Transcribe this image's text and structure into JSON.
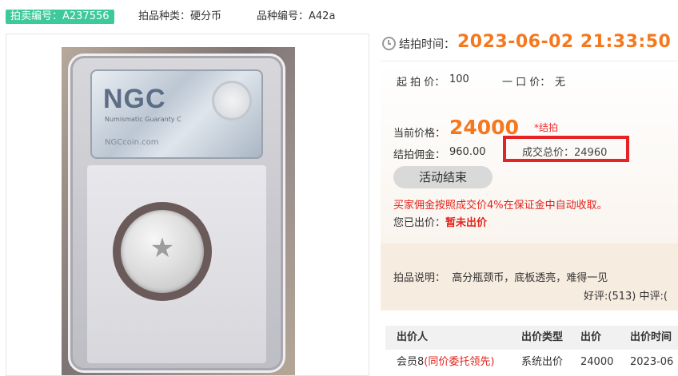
{
  "header": {
    "lot_id_label": "拍卖编号：A237556",
    "category_label": "拍品种类：",
    "category_value": "硬分币",
    "variety_label": "品种编号：",
    "variety_value": "A42a"
  },
  "photo": {
    "slab_logo": "NGC",
    "slab_subtitle": "Numismatic Guaranty C",
    "slab_website": "NGCcoin.com"
  },
  "auction": {
    "end_label": "结拍时间：",
    "end_time": "2023-06-02 21:33:50",
    "start_price_label": "起 拍 价：",
    "start_price": "100",
    "buy_now_label": "一 口 价：",
    "buy_now": "无",
    "current_price_label": "当前价格：",
    "current_price": "24000",
    "sold_tag": "*结拍",
    "commission_label": "结拍佣金：",
    "commission": "960.00",
    "total_label": "成交总价：",
    "total": "24960",
    "ended_button": "活动结束",
    "commission_note": "买家佣金按照成交价4%在保证金中自动收取。",
    "my_bid_label": "您已出价：",
    "my_bid_value": "暂未出价",
    "description_label": "拍品说明：",
    "description": "高分瓶颈币，底板透亮，难得一见",
    "rating": "好评:(513) 中评:("
  },
  "bids": {
    "headers": [
      "出价人",
      "出价类型",
      "出价",
      "出价时间"
    ],
    "rows": [
      {
        "bidder": "会员8",
        "bidder_note": "(同价委托领先)",
        "type": "系统出价",
        "price": "24000",
        "time": "2023-06"
      }
    ]
  },
  "colors": {
    "accent_orange": "#f5781e",
    "badge_green": "#3cc99b",
    "alert_red": "#e4231b",
    "highlight_box": "#e52225"
  },
  "icons": [
    "clock-icon"
  ]
}
